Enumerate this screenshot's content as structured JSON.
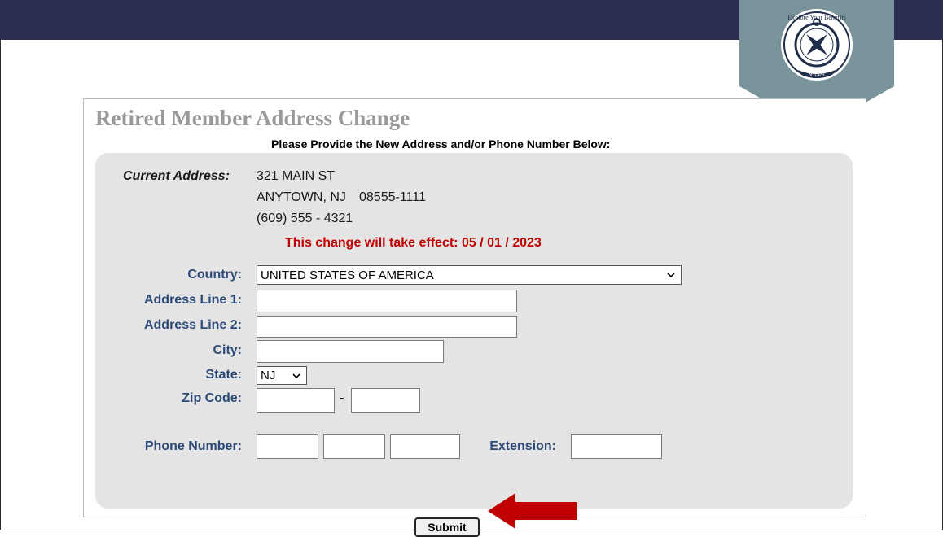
{
  "form": {
    "title": "Retired Member Address Change",
    "subtitle": "Please Provide the New Address and/or Phone Number Below:"
  },
  "current": {
    "label": "Current Address:",
    "line1": "321 MAIN ST",
    "city_state": "ANYTOWN, NJ",
    "zip": "08555-1111",
    "phone": "(609) 555 - 4321"
  },
  "effect_text": "This change will take effect:  05 / 01 / 2023",
  "fields": {
    "country_label": "Country:",
    "country_value": "UNITED STATES OF AMERICA",
    "address1_label": "Address Line 1:",
    "address2_label": "Address Line 2:",
    "city_label": "City:",
    "state_label": "State:",
    "state_value": "NJ",
    "zip_label": "Zip Code:",
    "zip_separator": "-",
    "phone_label": "Phone Number:",
    "extension_label": "Extension:"
  },
  "submit_label": "Submit",
  "badge": {
    "text_top": "Explore Your Benefits",
    "text_bottom": "NJDPB"
  },
  "colors": {
    "banner": "#2b2f4f",
    "badge": "#7a949b",
    "label": "#2c4a78",
    "effect": "#c00000",
    "arrow": "#c00000"
  }
}
